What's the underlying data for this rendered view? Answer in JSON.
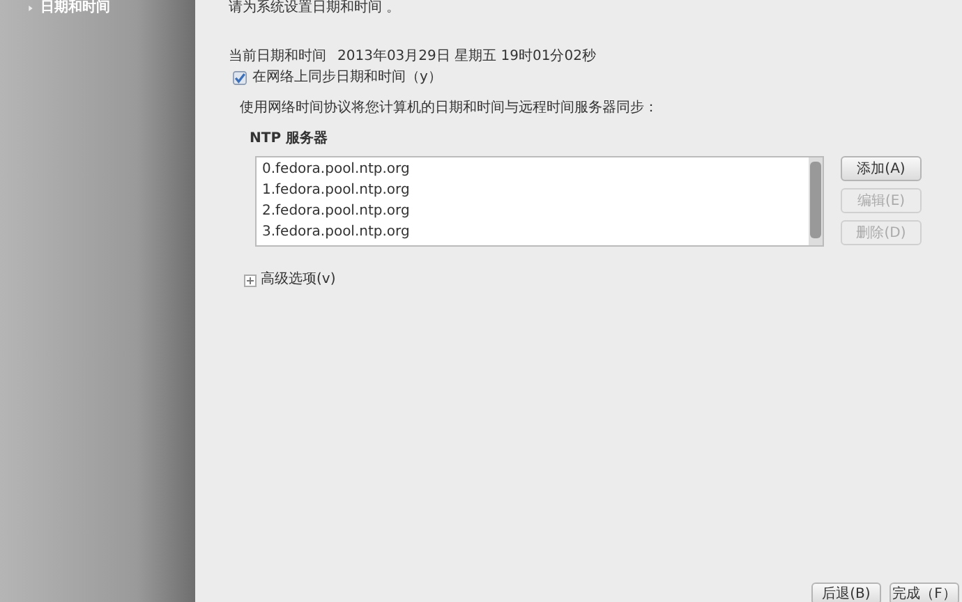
{
  "sidebar": {
    "items": [
      {
        "label": "日期和时间",
        "selected": true
      }
    ]
  },
  "intro": "请为系统设置日期和时间 。",
  "current": {
    "label": "当前日期和时间",
    "value": "2013年03月29日 星期五 19时01分02秒"
  },
  "sync": {
    "label": "在网络上同步日期和时间（y）",
    "checked": true
  },
  "ntp_note": "使用网络时间协议将您计算机的日期和时间与远程时间服务器同步：",
  "ntp_heading": "NTP 服务器",
  "servers": [
    "0.fedora.pool.ntp.org",
    "1.fedora.pool.ntp.org",
    "2.fedora.pool.ntp.org",
    "3.fedora.pool.ntp.org"
  ],
  "server_buttons": [
    {
      "label": "添加(A)",
      "disabled": false
    },
    {
      "label": "编辑(E)",
      "disabled": true
    },
    {
      "label": "删除(D)",
      "disabled": true
    }
  ],
  "advanced": {
    "label": "高级选项(v)",
    "expanded": false
  },
  "nav_buttons": [
    "后退(B)",
    "完成（F）"
  ]
}
